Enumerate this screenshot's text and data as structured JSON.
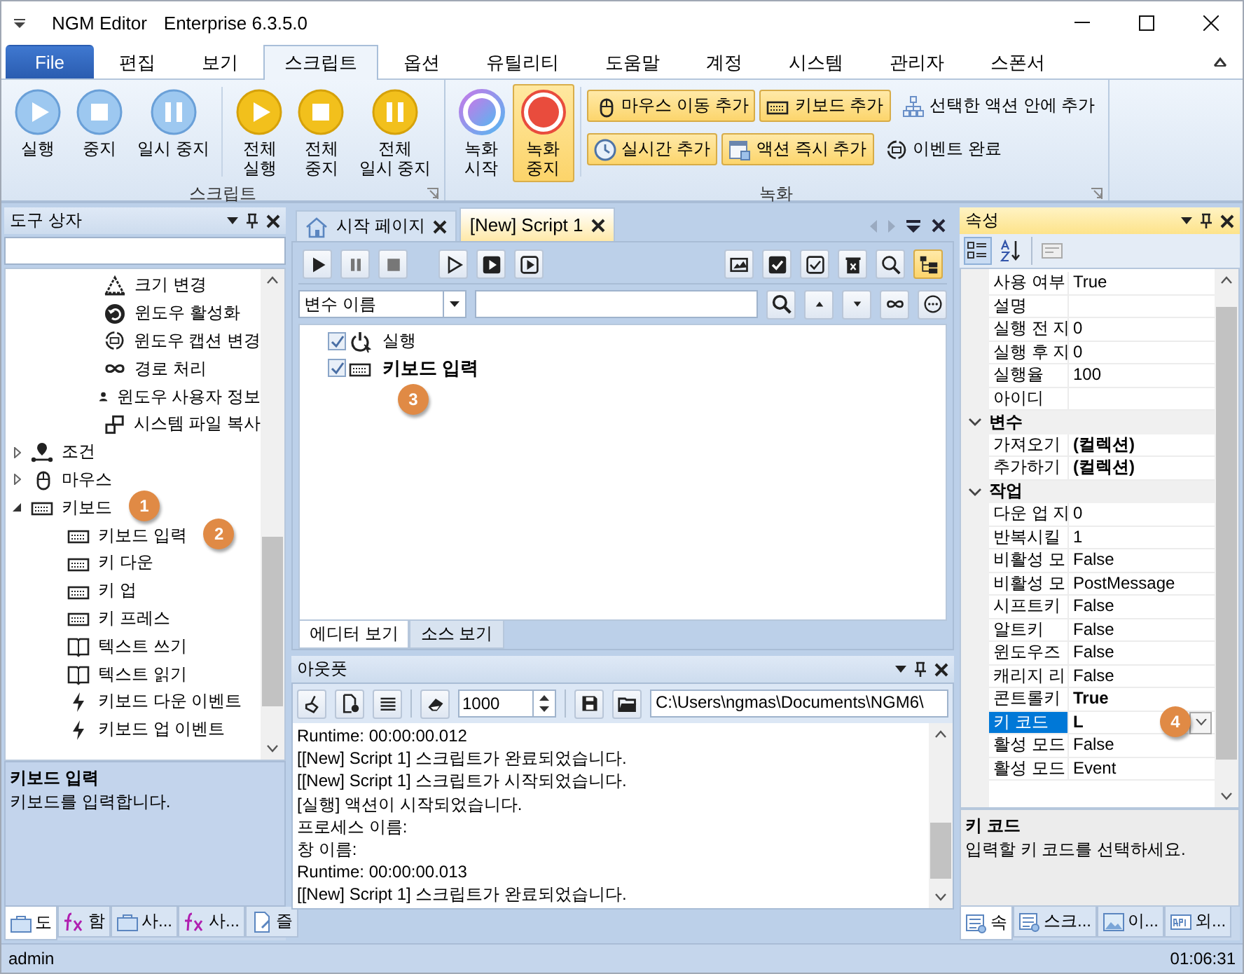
{
  "window": {
    "title": "NGM Editor",
    "edition": "Enterprise 6.3.5.0"
  },
  "menu_tabs": [
    {
      "label": "File",
      "kind": "file",
      "selected": false
    },
    {
      "label": "편집",
      "kind": "tab",
      "selected": false
    },
    {
      "label": "보기",
      "kind": "tab",
      "selected": false
    },
    {
      "label": "스크립트",
      "kind": "tab",
      "selected": true
    },
    {
      "label": "옵션",
      "kind": "tab",
      "selected": false
    },
    {
      "label": "유틸리티",
      "kind": "tab",
      "selected": false
    },
    {
      "label": "도움말",
      "kind": "tab",
      "selected": false
    },
    {
      "label": "계정",
      "kind": "tab",
      "selected": false
    },
    {
      "label": "시스템",
      "kind": "tab",
      "selected": false
    },
    {
      "label": "관리자",
      "kind": "tab",
      "selected": false
    },
    {
      "label": "스폰서",
      "kind": "tab",
      "selected": false
    }
  ],
  "ribbon": {
    "script_group": {
      "label": "스크립트",
      "buttons": [
        {
          "label": "실행",
          "kind": "play"
        },
        {
          "label": "중지",
          "kind": "stop"
        },
        {
          "label": "일시 중지",
          "kind": "pause"
        },
        {
          "label": "전체\n실행",
          "kind": "play-all"
        },
        {
          "label": "전체\n중지",
          "kind": "stop-all"
        },
        {
          "label": "전체\n일시 중지",
          "kind": "pause-all"
        }
      ]
    },
    "record_group": {
      "label": "녹화",
      "big_buttons": [
        {
          "label": "녹화\n시작",
          "kind": "record-start",
          "active": false
        },
        {
          "label": "녹화\n중지",
          "kind": "record-stop",
          "active": true
        }
      ],
      "small_buttons": [
        {
          "label": "마우스 이동 추가",
          "kind": "mouse",
          "highlighted": true
        },
        {
          "label": "키보드 추가",
          "kind": "keyboard",
          "highlighted": true
        },
        {
          "label": "선택한 액션 안에 추가",
          "kind": "hierarchy",
          "highlighted": false
        },
        {
          "label": "실시간 추가",
          "kind": "clock",
          "highlighted": true
        },
        {
          "label": "액션 즉시 추가",
          "kind": "window",
          "highlighted": true
        },
        {
          "label": "이벤트 완료",
          "kind": "refresh",
          "highlighted": false
        }
      ]
    }
  },
  "toolbox": {
    "title": "도구 상자",
    "tree": [
      {
        "children": [
          {
            "label": "크기 변경",
            "kind": "resize"
          },
          {
            "label": "윈도우 활성화",
            "kind": "undo"
          },
          {
            "label": "윈도우 캡션 변경",
            "kind": "refresh"
          },
          {
            "label": "경로 처리",
            "kind": "infinity"
          },
          {
            "label": "윈도우 사용자 정보",
            "kind": "person"
          },
          {
            "label": "시스템 파일 복사",
            "kind": "copy"
          }
        ]
      },
      {
        "label": "조건",
        "kind": "pin",
        "expanded": false
      },
      {
        "label": "마우스",
        "kind": "mouse",
        "expanded": false
      },
      {
        "label": "키보드",
        "kind": "keyboard",
        "expanded": true,
        "callout": "1",
        "children": [
          {
            "label": "키보드 입력",
            "kind": "keyboard",
            "callout": "2"
          },
          {
            "label": "키 다운",
            "kind": "keyboard"
          },
          {
            "label": "키 업",
            "kind": "keyboard"
          },
          {
            "label": "키 프레스",
            "kind": "keyboard"
          },
          {
            "label": "텍스트 쓰기",
            "kind": "book"
          },
          {
            "label": "텍스트 읽기",
            "kind": "book"
          },
          {
            "label": "키보드 다운 이벤트",
            "kind": "bolt"
          },
          {
            "label": "키보드 업 이벤트",
            "kind": "bolt"
          }
        ]
      }
    ],
    "description": {
      "title": "키보드 입력",
      "text": "키보드를 입력합니다."
    },
    "tabs": [
      {
        "label": "도",
        "kind": "toolbox",
        "selected": true
      },
      {
        "label": "함",
        "kind": "fx",
        "selected": false
      },
      {
        "label": "사...",
        "kind": "toolbox",
        "selected": false
      },
      {
        "label": "사...",
        "kind": "fx",
        "selected": false
      },
      {
        "label": "즐",
        "kind": "doc",
        "selected": false
      }
    ]
  },
  "editor": {
    "tabs": [
      {
        "label": "시작 페이지",
        "kind": "home",
        "selected": false
      },
      {
        "label": "[New] Script 1",
        "kind": "script",
        "selected": true
      }
    ],
    "variable_select": {
      "value": "변수 이름"
    },
    "script": [
      {
        "label": "실행",
        "kind": "power",
        "checked": true,
        "selected": false
      },
      {
        "label": "키보드 입력",
        "kind": "keyboard",
        "checked": true,
        "selected": true,
        "callout": "3"
      }
    ],
    "view_tabs": [
      {
        "label": "에디터 보기",
        "selected": true
      },
      {
        "label": "소스 보기",
        "selected": false
      }
    ]
  },
  "output": {
    "title": "아웃풋",
    "max_lines": "1000",
    "path": "C:\\Users\\ngmas\\Documents\\NGM6\\",
    "lines": [
      "Runtime: 00:00:00.012",
      "[[New] Script 1] 스크립트가 완료되었습니다.",
      "[[New] Script 1] 스크립트가 시작되었습니다.",
      "[실행] 액션이 시작되었습니다.",
      "프로세스 이름:",
      "창 이름:",
      "Runtime: 00:00:00.013",
      "[[New] Script 1] 스크립트가 완료되었습니다."
    ]
  },
  "properties": {
    "title": "속성",
    "groups": [
      {
        "rows": [
          {
            "name": "사용 여부",
            "value": "True",
            "selected": false
          },
          {
            "name": "설명",
            "selected": false
          },
          {
            "name": "실행 전 지",
            "value": "0",
            "selected": false
          },
          {
            "name": "실행 후 지",
            "value": "0",
            "selected": false
          },
          {
            "name": "실행율",
            "value": "100",
            "selected": false
          },
          {
            "name": "아이디",
            "selected": false
          }
        ]
      },
      {
        "label": "변수",
        "expanded": true,
        "rows": [
          {
            "name": "가져오기",
            "value": "(컬렉션)",
            "bold": true,
            "selected": false
          },
          {
            "name": "추가하기",
            "value": "(컬렉션)",
            "bold": true,
            "selected": false
          }
        ]
      },
      {
        "label": "작업",
        "expanded": true,
        "rows": [
          {
            "name": "다운 업 지",
            "value": "0",
            "selected": false
          },
          {
            "name": "반복시킬",
            "value": "1",
            "selected": false
          },
          {
            "name": "비활성 모",
            "value": "False",
            "selected": false
          },
          {
            "name": "비활성 모",
            "value": "PostMessage",
            "selected": false
          },
          {
            "name": "시프트키",
            "value": "False",
            "selected": false
          },
          {
            "name": "알트키",
            "value": "False",
            "selected": false
          },
          {
            "name": "윈도우즈",
            "value": "False",
            "selected": false
          },
          {
            "name": "캐리지 리",
            "value": "False",
            "selected": false
          },
          {
            "name": "콘트롤키",
            "value": "True",
            "bold": true,
            "selected": false
          },
          {
            "name": "키 코드",
            "value": "L",
            "bold": true,
            "selected": true,
            "callout": "4"
          },
          {
            "name": "활성 모드",
            "value": "False",
            "selected": false
          },
          {
            "name": "활성 모드",
            "value": "Event",
            "selected": false
          }
        ]
      }
    ],
    "description": {
      "title": "키 코드",
      "text": "입력할 키 코드를 선택하세요."
    },
    "tabs": [
      {
        "label": "속",
        "kind": "props",
        "selected": true
      },
      {
        "label": "스크...",
        "kind": "props",
        "selected": false
      },
      {
        "label": "이...",
        "kind": "image",
        "selected": false
      },
      {
        "label": "외...",
        "kind": "api",
        "selected": false
      }
    ]
  },
  "status_bar": {
    "user": "admin",
    "time": "01:06:31"
  }
}
